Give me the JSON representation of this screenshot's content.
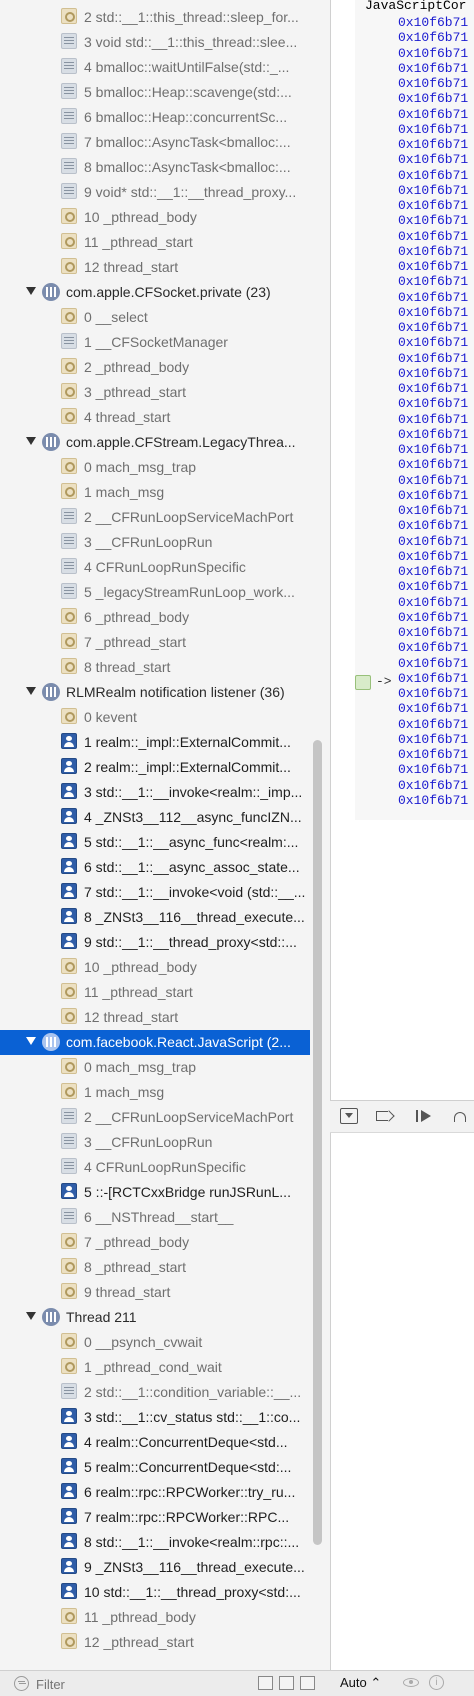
{
  "navigator": {
    "rows": [
      {
        "kind": "frame",
        "icon": "sys",
        "dim": true,
        "text": "2 std::__1::this_thread::sleep_for..."
      },
      {
        "kind": "frame",
        "icon": "lib",
        "dim": true,
        "text": "3 void std::__1::this_thread::slee..."
      },
      {
        "kind": "frame",
        "icon": "lib",
        "dim": true,
        "text": "4 bmalloc::waitUntilFalse(std::_..."
      },
      {
        "kind": "frame",
        "icon": "lib",
        "dim": true,
        "text": "5 bmalloc::Heap::scavenge(std:..."
      },
      {
        "kind": "frame",
        "icon": "lib",
        "dim": true,
        "text": "6 bmalloc::Heap::concurrentSc..."
      },
      {
        "kind": "frame",
        "icon": "lib",
        "dim": true,
        "text": "7 bmalloc::AsyncTask<bmalloc:..."
      },
      {
        "kind": "frame",
        "icon": "lib",
        "dim": true,
        "text": "8 bmalloc::AsyncTask<bmalloc:..."
      },
      {
        "kind": "frame",
        "icon": "lib",
        "dim": true,
        "text": "9 void* std::__1::__thread_proxy..."
      },
      {
        "kind": "frame",
        "icon": "sys",
        "dim": true,
        "text": "10 _pthread_body"
      },
      {
        "kind": "frame",
        "icon": "sys",
        "dim": true,
        "text": "11 _pthread_start"
      },
      {
        "kind": "frame",
        "icon": "sys",
        "dim": true,
        "text": "12 thread_start"
      },
      {
        "kind": "thread",
        "text": "com.apple.CFSocket.private (23)"
      },
      {
        "kind": "frame",
        "icon": "sys",
        "dim": true,
        "text": "0 __select"
      },
      {
        "kind": "frame",
        "icon": "lib",
        "dim": true,
        "text": "1 __CFSocketManager"
      },
      {
        "kind": "frame",
        "icon": "sys",
        "dim": true,
        "text": "2 _pthread_body"
      },
      {
        "kind": "frame",
        "icon": "sys",
        "dim": true,
        "text": "3 _pthread_start"
      },
      {
        "kind": "frame",
        "icon": "sys",
        "dim": true,
        "text": "4 thread_start"
      },
      {
        "kind": "thread",
        "text": "com.apple.CFStream.LegacyThrea..."
      },
      {
        "kind": "frame",
        "icon": "sys",
        "dim": true,
        "text": "0 mach_msg_trap"
      },
      {
        "kind": "frame",
        "icon": "sys",
        "dim": true,
        "text": "1 mach_msg"
      },
      {
        "kind": "frame",
        "icon": "lib",
        "dim": true,
        "text": "2 __CFRunLoopServiceMachPort"
      },
      {
        "kind": "frame",
        "icon": "lib",
        "dim": true,
        "text": "3 __CFRunLoopRun"
      },
      {
        "kind": "frame",
        "icon": "lib",
        "dim": true,
        "text": "4 CFRunLoopRunSpecific"
      },
      {
        "kind": "frame",
        "icon": "lib",
        "dim": true,
        "text": "5 _legacyStreamRunLoop_work..."
      },
      {
        "kind": "frame",
        "icon": "sys",
        "dim": true,
        "text": "6 _pthread_body"
      },
      {
        "kind": "frame",
        "icon": "sys",
        "dim": true,
        "text": "7 _pthread_start"
      },
      {
        "kind": "frame",
        "icon": "sys",
        "dim": true,
        "text": "8 thread_start"
      },
      {
        "kind": "thread",
        "text": "RLMRealm notification listener (36)"
      },
      {
        "kind": "frame",
        "icon": "sys",
        "dim": true,
        "text": "0 kevent"
      },
      {
        "kind": "frame",
        "icon": "user",
        "dim": false,
        "text": "1 realm::_impl::ExternalCommit..."
      },
      {
        "kind": "frame",
        "icon": "user",
        "dim": false,
        "text": "2 realm::_impl::ExternalCommit..."
      },
      {
        "kind": "frame",
        "icon": "user",
        "dim": false,
        "text": "3 std::__1::__invoke<realm::_imp..."
      },
      {
        "kind": "frame",
        "icon": "user",
        "dim": false,
        "text": "4 _ZNSt3__112__async_funcIZN..."
      },
      {
        "kind": "frame",
        "icon": "user",
        "dim": false,
        "text": "5 std::__1::__async_func<realm:..."
      },
      {
        "kind": "frame",
        "icon": "user",
        "dim": false,
        "text": "6 std::__1::__async_assoc_state..."
      },
      {
        "kind": "frame",
        "icon": "user",
        "dim": false,
        "text": "7 std::__1::__invoke<void (std::__..."
      },
      {
        "kind": "frame",
        "icon": "user",
        "dim": false,
        "text": "8 _ZNSt3__116__thread_execute..."
      },
      {
        "kind": "frame",
        "icon": "user",
        "dim": false,
        "text": "9 std::__1::__thread_proxy<std::..."
      },
      {
        "kind": "frame",
        "icon": "sys",
        "dim": true,
        "text": "10 _pthread_body"
      },
      {
        "kind": "frame",
        "icon": "sys",
        "dim": true,
        "text": "11 _pthread_start"
      },
      {
        "kind": "frame",
        "icon": "sys",
        "dim": true,
        "text": "12 thread_start"
      },
      {
        "kind": "thread",
        "selected": true,
        "text": "com.facebook.React.JavaScript (2..."
      },
      {
        "kind": "frame",
        "icon": "sys",
        "dim": true,
        "text": "0 mach_msg_trap"
      },
      {
        "kind": "frame",
        "icon": "sys",
        "dim": true,
        "text": "1 mach_msg"
      },
      {
        "kind": "frame",
        "icon": "lib",
        "dim": true,
        "text": "2 __CFRunLoopServiceMachPort"
      },
      {
        "kind": "frame",
        "icon": "lib",
        "dim": true,
        "text": "3 __CFRunLoopRun"
      },
      {
        "kind": "frame",
        "icon": "lib",
        "dim": true,
        "text": "4 CFRunLoopRunSpecific"
      },
      {
        "kind": "frame",
        "icon": "user",
        "dim": false,
        "text": "5 ::-[RCTCxxBridge runJSRunL..."
      },
      {
        "kind": "frame",
        "icon": "lib",
        "dim": true,
        "text": "6 __NSThread__start__"
      },
      {
        "kind": "frame",
        "icon": "sys",
        "dim": true,
        "text": "7 _pthread_body"
      },
      {
        "kind": "frame",
        "icon": "sys",
        "dim": true,
        "text": "8 _pthread_start"
      },
      {
        "kind": "frame",
        "icon": "sys",
        "dim": true,
        "text": "9 thread_start"
      },
      {
        "kind": "thread",
        "text": "Thread 211"
      },
      {
        "kind": "frame",
        "icon": "sys",
        "dim": true,
        "text": "0 __psynch_cvwait"
      },
      {
        "kind": "frame",
        "icon": "sys",
        "dim": true,
        "text": "1 _pthread_cond_wait"
      },
      {
        "kind": "frame",
        "icon": "lib",
        "dim": true,
        "text": "2 std::__1::condition_variable::__..."
      },
      {
        "kind": "frame",
        "icon": "user",
        "dim": false,
        "text": "3 std::__1::cv_status std::__1::co..."
      },
      {
        "kind": "frame",
        "icon": "user",
        "dim": false,
        "text": "4 realm::ConcurrentDeque<std..."
      },
      {
        "kind": "frame",
        "icon": "user",
        "dim": false,
        "text": "5 realm::ConcurrentDeque<std:..."
      },
      {
        "kind": "frame",
        "icon": "user",
        "dim": false,
        "text": "6 realm::rpc::RPCWorker::try_ru..."
      },
      {
        "kind": "frame",
        "icon": "user",
        "dim": false,
        "text": "7 realm::rpc::RPCWorker::RPC..."
      },
      {
        "kind": "frame",
        "icon": "user",
        "dim": false,
        "text": "8 std::__1::__invoke<realm::rpc::..."
      },
      {
        "kind": "frame",
        "icon": "user",
        "dim": false,
        "text": "9 _ZNSt3__116__thread_execute..."
      },
      {
        "kind": "frame",
        "icon": "user",
        "dim": false,
        "text": "10 std::__1::__thread_proxy<std:..."
      },
      {
        "kind": "frame",
        "icon": "sys",
        "dim": true,
        "text": "11 _pthread_body"
      },
      {
        "kind": "frame",
        "icon": "sys",
        "dim": true,
        "text": "12 _pthread_start"
      }
    ],
    "filter_placeholder": "Filter"
  },
  "disassembly": {
    "header": "JavaScriptCor",
    "address_prefix": "0x10f6b71",
    "address_count": 52,
    "pc_row_index": 42,
    "pc_arrow": "->"
  },
  "variables": {
    "scope": "Auto"
  },
  "colors": {
    "selection": "#0a61d4",
    "address_text": "#1a1ad0",
    "pc_marker": "#d8ebc9"
  }
}
